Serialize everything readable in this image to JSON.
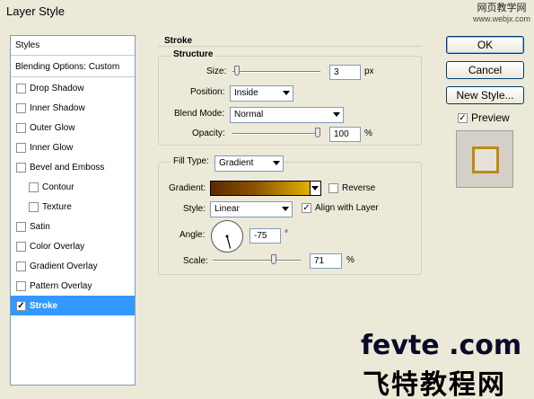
{
  "window": {
    "title": "Layer Style"
  },
  "watermark_top": {
    "line1": "网页教学网",
    "line2": "www.webjx.com"
  },
  "styles_panel": {
    "header": "Styles",
    "blending": "Blending Options: Custom",
    "items": [
      {
        "label": "Drop Shadow",
        "checked": false
      },
      {
        "label": "Inner Shadow",
        "checked": false
      },
      {
        "label": "Outer Glow",
        "checked": false
      },
      {
        "label": "Inner Glow",
        "checked": false
      },
      {
        "label": "Bevel and Emboss",
        "checked": false
      },
      {
        "label": "Contour",
        "checked": false
      },
      {
        "label": "Texture",
        "checked": false
      },
      {
        "label": "Satin",
        "checked": false
      },
      {
        "label": "Color Overlay",
        "checked": false
      },
      {
        "label": "Gradient Overlay",
        "checked": false
      },
      {
        "label": "Pattern Overlay",
        "checked": false
      },
      {
        "label": "Stroke",
        "checked": true
      }
    ]
  },
  "stroke": {
    "title": "Stroke",
    "structure": {
      "legend": "Structure",
      "size_label": "Size:",
      "size_value": "3",
      "size_unit": "px",
      "size_slider": 0.02,
      "position_label": "Position:",
      "position_value": "Inside",
      "blend_label": "Blend Mode:",
      "blend_value": "Normal",
      "opacity_label": "Opacity:",
      "opacity_value": "100",
      "opacity_unit": "%",
      "opacity_slider": 1.0
    },
    "fill": {
      "legend": "Fill Type:",
      "fill_type": "Gradient",
      "gradient_label": "Gradient:",
      "gradient_colors": [
        "#5a2a00",
        "#8a5200",
        "#f2c200"
      ],
      "reverse_label": "Reverse",
      "reverse_checked": false,
      "style_label": "Style:",
      "style_value": "Linear",
      "align_label": "Align with Layer",
      "align_checked": true,
      "angle_label": "Angle:",
      "angle_value": "-75",
      "angle_unit": "°",
      "scale_label": "Scale:",
      "scale_value": "71",
      "scale_unit": "%",
      "scale_slider": 0.71
    }
  },
  "buttons": {
    "ok": "OK",
    "cancel": "Cancel",
    "new_style": "New Style..."
  },
  "preview": {
    "label": "Preview",
    "checked": true,
    "stroke_color": "#c08a10"
  },
  "brand": {
    "latin": "fevte .com",
    "cn": "飞特教程网"
  }
}
